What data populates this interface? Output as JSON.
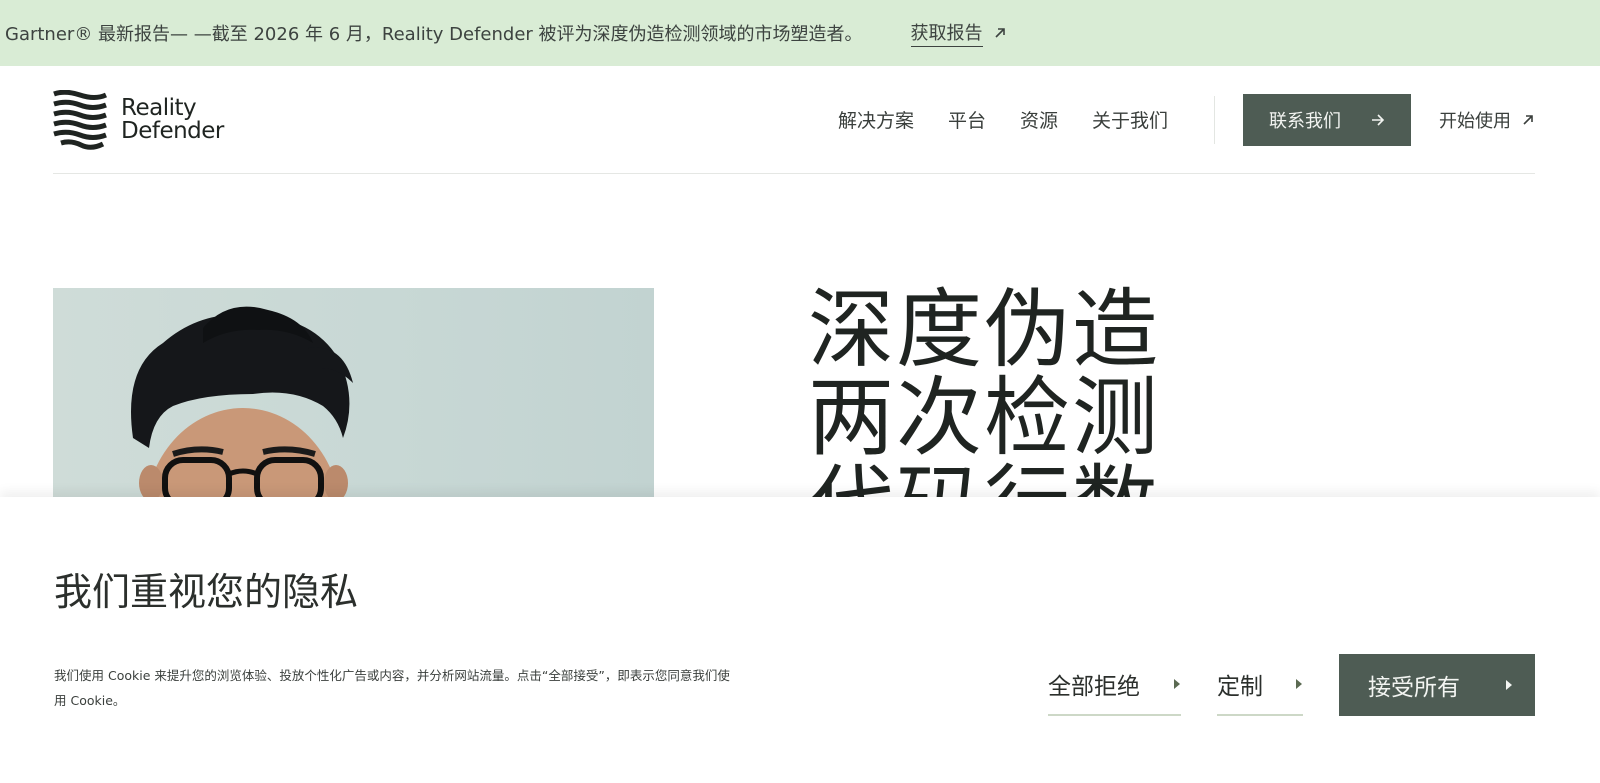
{
  "banner": {
    "text": "Gartner® 最新报告— —截至 2026 年 6 月，Reality Defender 被评为深度伪造检测领域的市场塑造者。",
    "cta_label": "获取报告",
    "cta_icon": "arrow-up-right-icon"
  },
  "header": {
    "logo_line1": "Reality",
    "logo_line2": "Defender",
    "nav": [
      "解决方案",
      "平台",
      "资源",
      "关于我们"
    ],
    "contact_label": "联系我们",
    "start_label": "开始使用"
  },
  "hero": {
    "title_lines": [
      "深度伪造",
      "两次检测",
      "代码行数"
    ]
  },
  "cookie": {
    "title": "我们重视您的隐私",
    "text_line1": "我们使用 Cookie 来提升您的浏览体验、投放个性化广告或内容，并分析网站流量。点击“全部接受”，即表示您同意我们使",
    "text_line2": "用 Cookie。",
    "reject_label": "全部拒绝",
    "customize_label": "定制",
    "accept_label": "接受所有"
  },
  "colors": {
    "banner_bg": "#d9ecd5",
    "button_bg": "#4e5c54",
    "underline": "#cdd8c7"
  }
}
